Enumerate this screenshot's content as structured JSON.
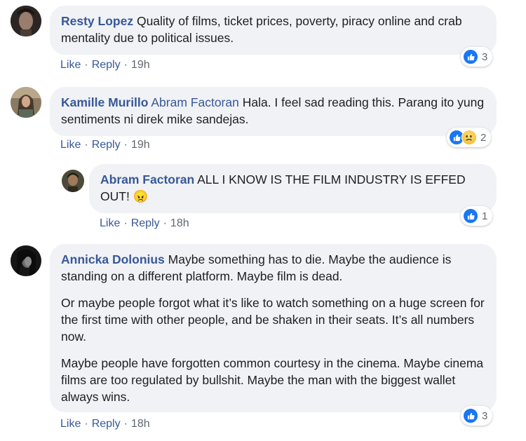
{
  "comments": [
    {
      "author": "Resty Lopez",
      "mention": "",
      "paragraphs": [
        "Quality of films, ticket prices, poverty, piracy online and crab mentality due to political issues."
      ],
      "like_label": "Like",
      "reply_label": "Reply",
      "time": "19h",
      "reaction_count": "3",
      "reactions": [
        "like-icon"
      ]
    },
    {
      "author": "Kamille Murillo",
      "mention": "Abram Factoran",
      "paragraphs": [
        "Hala. I feel sad reading this. Parang ito yung sentiments ni direk mike sandejas."
      ],
      "like_label": "Like",
      "reply_label": "Reply",
      "time": "19h",
      "reaction_count": "2",
      "reactions": [
        "like-icon",
        "sad-icon"
      ]
    },
    {
      "author": "Abram Factoran",
      "mention": "",
      "paragraphs": [
        "ALL I KNOW IS THE FILM INDUSTRY IS EFFED OUT! 😠"
      ],
      "like_label": "Like",
      "reply_label": "Reply",
      "time": "18h",
      "reaction_count": "1",
      "reactions": [
        "like-icon"
      ]
    },
    {
      "author": "Annicka Dolonius",
      "mention": "",
      "paragraphs": [
        "Maybe something has to die. Maybe the audience is standing on a different platform. Maybe film is dead.",
        "Or maybe people forgot what it’s like to watch something on a huge screen for the first time with other people, and be shaken in their seats. It’s all numbers now.",
        "Maybe people have forgotten common courtesy in the cinema. Maybe cinema films are too regulated by bullshit. Maybe the man with the biggest wallet always wins."
      ],
      "like_label": "Like",
      "reply_label": "Reply",
      "time": "18h",
      "reaction_count": "3",
      "reactions": [
        "like-icon"
      ]
    }
  ],
  "colors": {
    "link": "#385898",
    "bubble": "#f0f2f5",
    "like_blue": "#1877f2",
    "meta_gray": "#606770"
  }
}
